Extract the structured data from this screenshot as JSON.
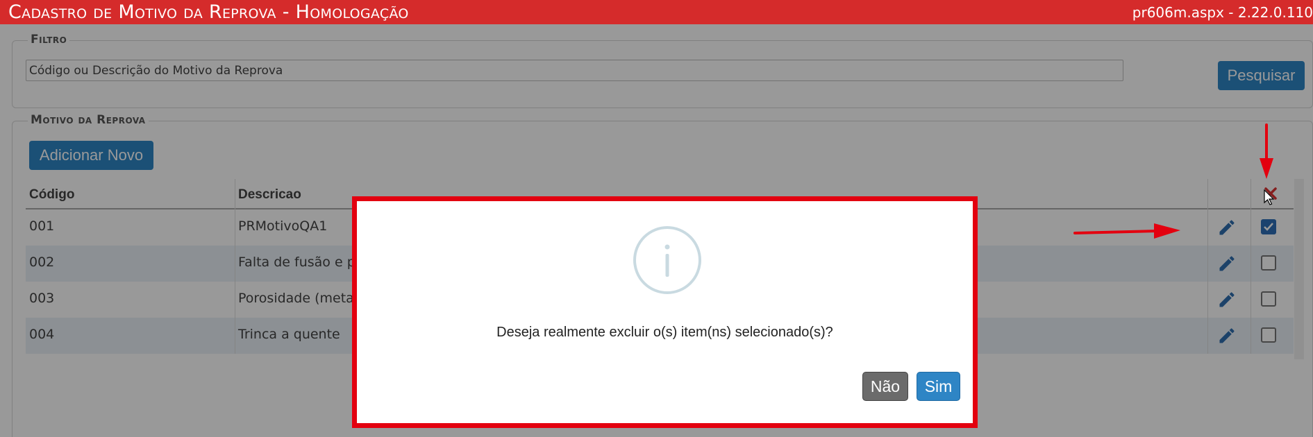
{
  "header": {
    "title": "Cadastro de Motivo da Reprova  - Homologação",
    "version": "pr606m.aspx - 2.22.0.110"
  },
  "filter": {
    "legend": "Filtro",
    "input_value": "Código ou Descrição do Motivo da Reprova",
    "search_label": "Pesquisar"
  },
  "reprova": {
    "legend": "Motivo da Reprova",
    "add_label": "Adicionar Novo"
  },
  "table": {
    "headers": {
      "codigo": "Código",
      "descricao": "Descricao"
    },
    "rows": [
      {
        "codigo": "001",
        "descricao": "PRMotivoQA1",
        "checked": true
      },
      {
        "codigo": "002",
        "descricao": "Falta de fusão e p",
        "checked": false
      },
      {
        "codigo": "003",
        "descricao": "Porosidade (meta",
        "checked": false
      },
      {
        "codigo": "004",
        "descricao": "Trinca a quente",
        "checked": false
      }
    ]
  },
  "dialog": {
    "message": "Deseja realmente excluir o(s) item(ns) selecionado(s)?",
    "no_label": "Não",
    "yes_label": "Sim"
  },
  "colors": {
    "header_bg": "#d52b2b",
    "primary_button": "#2e85c5",
    "annotation_red": "#e3000f",
    "row_alt": "#e9f0f7"
  },
  "icons": [
    "pencil-icon",
    "delete-x-icon",
    "info-icon",
    "checkbox",
    "cursor-icon"
  ]
}
